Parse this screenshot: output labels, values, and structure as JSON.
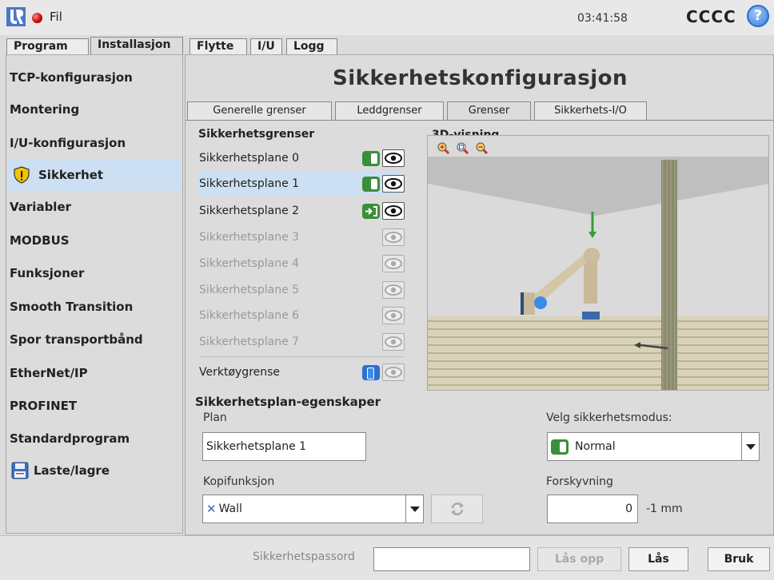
{
  "topbar": {
    "file_label": "Fil",
    "clock": "03:41:58",
    "robot_name": "CCCC",
    "help_symbol": "?"
  },
  "main_tabs": [
    {
      "label": "Program"
    },
    {
      "label": "Installasjon"
    },
    {
      "label": "Flytte"
    },
    {
      "label": "I/U"
    },
    {
      "label": "Logg"
    }
  ],
  "sidebar": {
    "items": [
      {
        "label": "TCP-konfigurasjon"
      },
      {
        "label": "Montering"
      },
      {
        "label": "I/U-konfigurasjon"
      },
      {
        "label": "Sikkerhet",
        "icon": "shield-warning-icon"
      },
      {
        "label": "Variabler"
      },
      {
        "label": "MODBUS"
      },
      {
        "label": "Funksjoner"
      },
      {
        "label": "Smooth Transition"
      },
      {
        "label": "Spor transportbånd"
      },
      {
        "label": "EtherNet/IP"
      },
      {
        "label": "PROFINET"
      },
      {
        "label": "Standardprogram"
      },
      {
        "label": "Laste/lagre",
        "icon": "save-icon"
      }
    ]
  },
  "main": {
    "title": "Sikkerhetskonfigurasjon",
    "tabs": [
      {
        "label": "Generelle grenser"
      },
      {
        "label": "Leddgrenser"
      },
      {
        "label": "Grenser"
      },
      {
        "label": "Sikkerhets-I/O"
      }
    ],
    "limits_heading": "Sikkerhetsgrenser",
    "planes": [
      {
        "label": "Sikkerhetsplane 0"
      },
      {
        "label": "Sikkerhetsplane 1"
      },
      {
        "label": "Sikkerhetsplane 2"
      },
      {
        "label": "Sikkerhetsplane 3"
      },
      {
        "label": "Sikkerhetsplane 4"
      },
      {
        "label": "Sikkerhetsplane 5"
      },
      {
        "label": "Sikkerhetsplane 6"
      },
      {
        "label": "Sikkerhetsplane 7"
      }
    ],
    "tool_limit_label": "Verktøygrense",
    "view_heading": "3D-visning",
    "props_heading": "Sikkerhetsplan-egenskaper",
    "plan_label": "Plan",
    "plan_value": "Sikkerhetsplane 1",
    "copy_label": "Kopifunksjon",
    "copy_value": "Wall",
    "mode_label": "Velg sikkerhetsmodus:",
    "mode_value": "Normal",
    "offset_label": "Forskyvning",
    "offset_value": "0",
    "offset_unit": "-1 mm"
  },
  "footer": {
    "password_label": "Sikkerhetspassord",
    "unlock_label": "Lås opp",
    "lock_label": "Lås",
    "apply_label": "Bruk"
  }
}
